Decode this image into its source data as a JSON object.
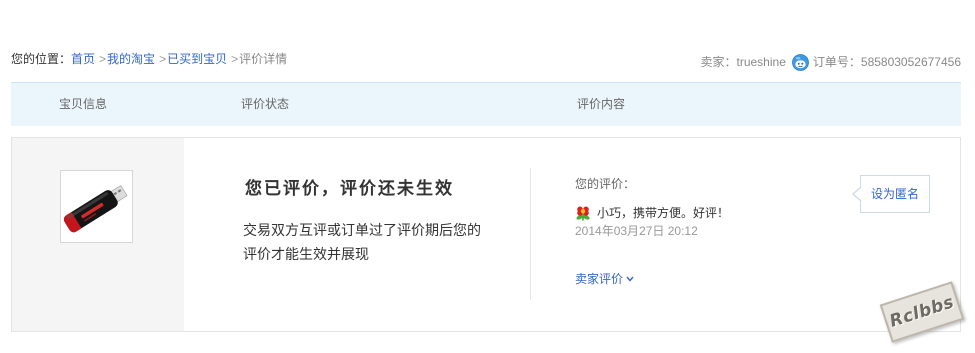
{
  "breadcrumb": {
    "prefix": "您的位置：",
    "separator": ">",
    "items": [
      {
        "label": "首页"
      },
      {
        "label": "我的淘宝"
      },
      {
        "label": "已买到宝贝"
      },
      {
        "label": "评价详情"
      }
    ]
  },
  "order_info": {
    "seller_label": "卖家：",
    "seller_name": "trueshine",
    "contact_icon": "wangwang-icon",
    "order_label": "订单号：",
    "order_number": "585803052677456"
  },
  "table_header": {
    "columns": [
      "宝贝信息",
      "评价状态",
      "评价内容"
    ]
  },
  "item": {
    "thumbnail_icon": "usb-flash-drive",
    "status": {
      "title": "您已评价，评价还未生效",
      "description_lines": [
        "交易双方互评或订单过了评价期后您的",
        "评价才能生效并展现"
      ]
    },
    "review": {
      "label": "您的评价：",
      "rating_icon": "good-rating-flower-icon",
      "text": "小巧，携带方便。好评！",
      "time": "2014年03月27日 20:12"
    },
    "seller_review_toggle": {
      "label": "卖家评价",
      "icon": "chevron-down-icon"
    },
    "anonymous_button": {
      "label": "设为匿名"
    }
  },
  "watermark": "Rclbbs",
  "colors": {
    "link": "#3366cc",
    "header_background": "#ebf5fc",
    "panel_background": "#f5f5f5",
    "border": "#e4e4e4",
    "muted_text": "#888888"
  }
}
